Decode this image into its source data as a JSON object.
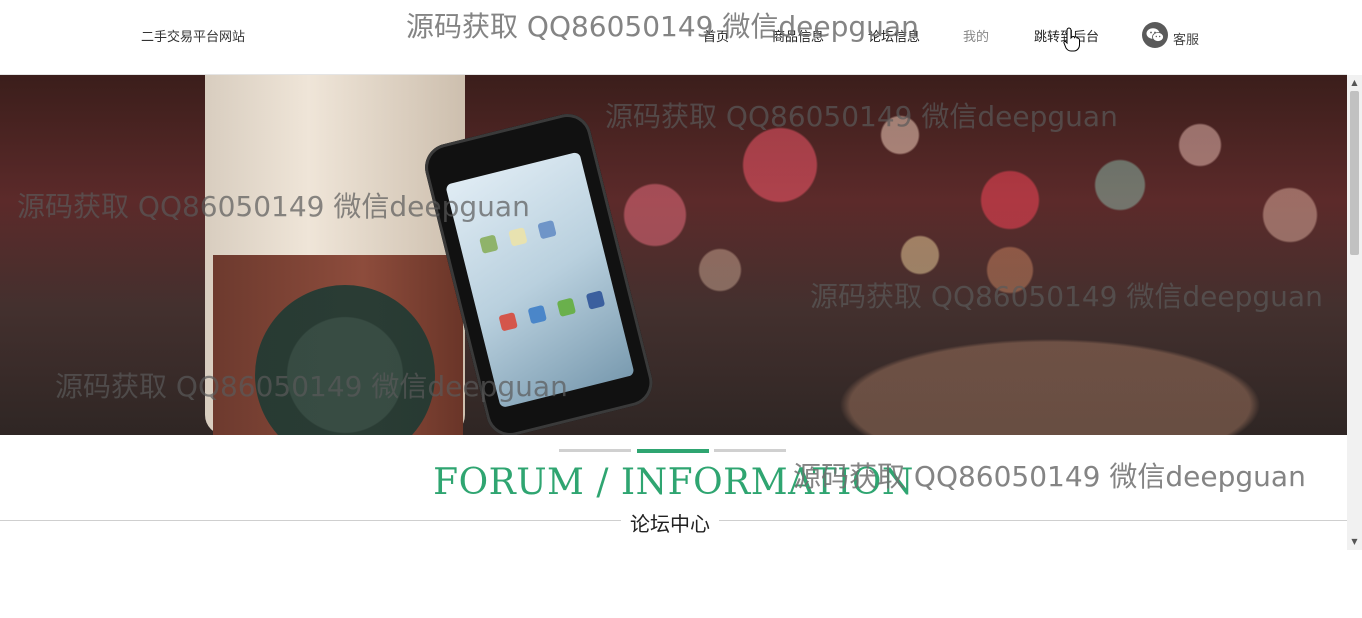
{
  "header": {
    "site_name": "二手交易平台网站",
    "nav": {
      "home": "首页",
      "goods": "商品信息",
      "forum": "论坛信息",
      "mine": "我的",
      "backend": "跳转到后台"
    },
    "service_label": "客服"
  },
  "watermark": {
    "text": "源码获取 QQ86050149 微信deepguan"
  },
  "banner": {
    "slides_count": 3,
    "active_slide": 2
  },
  "section": {
    "title": "FORUM / INFORMATION",
    "subtitle": "论坛中心"
  },
  "colors": {
    "accent": "#2fa571",
    "watermark": "#6e6e6e"
  },
  "icons": {
    "service": "wechat-icon",
    "cursor": "hand-pointer-icon"
  }
}
